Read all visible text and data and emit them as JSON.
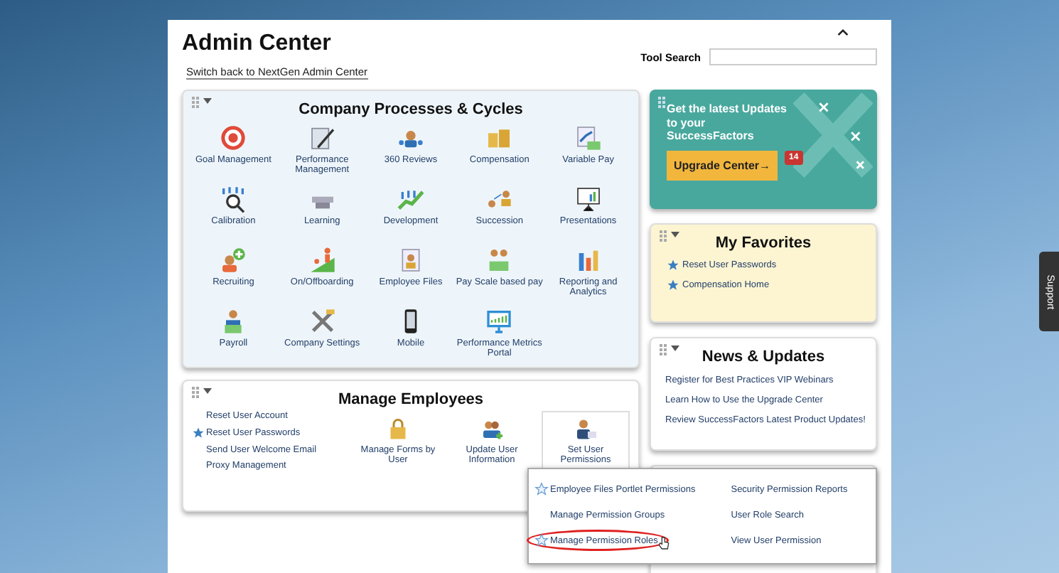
{
  "page": {
    "title": "Admin Center",
    "switch_link": "Switch back to NextGen Admin Center",
    "tool_search": {
      "label": "Tool Search"
    }
  },
  "processes": {
    "title": "Company Processes & Cycles",
    "tiles": [
      {
        "label": "Goal Management"
      },
      {
        "label": "Performance Management"
      },
      {
        "label": "360 Reviews"
      },
      {
        "label": "Compensation"
      },
      {
        "label": "Variable Pay"
      },
      {
        "label": "Calibration"
      },
      {
        "label": "Learning"
      },
      {
        "label": "Development"
      },
      {
        "label": "Succession"
      },
      {
        "label": "Presentations"
      },
      {
        "label": "Recruiting"
      },
      {
        "label": "On/Offboarding"
      },
      {
        "label": "Employee Files"
      },
      {
        "label": "Pay Scale based pay"
      },
      {
        "label": "Reporting and Analytics"
      },
      {
        "label": "Payroll"
      },
      {
        "label": "Company Settings"
      },
      {
        "label": "Mobile"
      },
      {
        "label": "Performance Metrics Portal"
      }
    ]
  },
  "manage_employees": {
    "title": "Manage Employees",
    "links": [
      {
        "label": "Reset User Account",
        "starred": false
      },
      {
        "label": "Reset User Passwords",
        "starred": true
      },
      {
        "label": "Send User Welcome Email",
        "starred": false
      },
      {
        "label": "Proxy Management",
        "starred": false
      }
    ],
    "tiles": [
      {
        "label": "Manage Forms by User",
        "selected": false
      },
      {
        "label": "Update User Information",
        "selected": false
      },
      {
        "label": "Set User Permissions",
        "selected": true
      }
    ]
  },
  "upgrade": {
    "text": "Get the latest Updates to your SuccessFactors",
    "button": "Upgrade Center",
    "arrow": "→",
    "badge": "14"
  },
  "favorites": {
    "title": "My Favorites",
    "items": [
      "Reset User Passwords",
      "Compensation Home"
    ]
  },
  "news": {
    "title": "News & Updates",
    "items": [
      "Register for Best Practices VIP Webinars",
      "Learn How to Use the Upgrade Center",
      "Review SuccessFactors Latest Product Updates!"
    ]
  },
  "permissions_menu": {
    "columns": [
      [
        {
          "label": "Employee Files Portlet Permissions",
          "star": true,
          "circled": false
        },
        {
          "label": "Manage Permission Groups",
          "star": false,
          "circled": false
        },
        {
          "label": "Manage Permission Roles",
          "star": true,
          "circled": true
        }
      ],
      [
        {
          "label": "Security Permission Reports",
          "star": false,
          "circled": false
        },
        {
          "label": "User Role Search",
          "star": false,
          "circled": false
        },
        {
          "label": "View User Permission",
          "star": false,
          "circled": false
        }
      ]
    ]
  },
  "support_tab": "Support"
}
